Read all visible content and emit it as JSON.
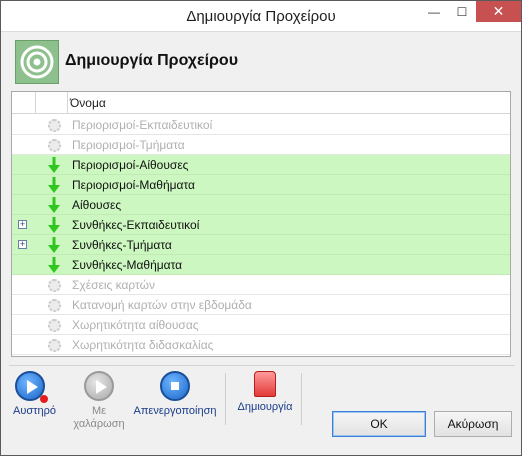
{
  "window": {
    "title": "Δημιουργία Προχείρου",
    "controls": {
      "minimize": "—",
      "maximize": "☐",
      "close": "✕"
    }
  },
  "header": {
    "title": "Δημιουργία Προχείρου",
    "icon": "target-icon"
  },
  "grid": {
    "columns": [
      "",
      "",
      "Όνομα"
    ],
    "rows": [
      {
        "label": "Περιορισμοί-Εκπαιδευτικοί",
        "state": "inactive",
        "icon": "gear-icon",
        "expandable": false
      },
      {
        "label": "Περιορισμοί-Τμήματα",
        "state": "inactive",
        "icon": "gear-icon",
        "expandable": false
      },
      {
        "label": "Περιορισμοί-Αίθουσες",
        "state": "active",
        "icon": "arrow-down-icon",
        "expandable": false
      },
      {
        "label": "Περιορισμοί-Μαθήματα",
        "state": "active",
        "icon": "arrow-down-icon",
        "expandable": false
      },
      {
        "label": "Αίθουσες",
        "state": "active",
        "icon": "arrow-down-icon",
        "expandable": false
      },
      {
        "label": "Συνθήκες-Εκπαιδευτικοί",
        "state": "active",
        "icon": "arrow-down-icon",
        "expandable": true
      },
      {
        "label": "Συνθήκες-Τμήματα",
        "state": "active",
        "icon": "arrow-down-icon",
        "expandable": true
      },
      {
        "label": "Συνθήκες-Μαθήματα",
        "state": "active",
        "icon": "arrow-down-icon",
        "expandable": false
      },
      {
        "label": "Σχέσεις καρτών",
        "state": "inactive",
        "icon": "gear-icon",
        "expandable": false
      },
      {
        "label": "Κατανομή καρτών στην εβδομάδα",
        "state": "inactive",
        "icon": "gear-icon",
        "expandable": false
      },
      {
        "label": "Χωρητικότητα αίθουσας",
        "state": "inactive",
        "icon": "gear-icon",
        "expandable": false
      },
      {
        "label": "Χωρητικότητα διδασκαλίας",
        "state": "inactive",
        "icon": "gear-icon",
        "expandable": false
      }
    ]
  },
  "toolbar": {
    "strict_label": "Αυστηρό",
    "relax_label": "Με χαλάρωση",
    "disable_label": "Απενεργοποίηση",
    "create_label": "Δημιουργία"
  },
  "buttons": {
    "ok_label": "OK",
    "cancel_label": "Ακύρωση"
  },
  "colors": {
    "active_row": "#ccf7c0",
    "inactive_text": "#b0b0b0",
    "arrow": "#2fc71f",
    "close_button": "#c75050"
  }
}
